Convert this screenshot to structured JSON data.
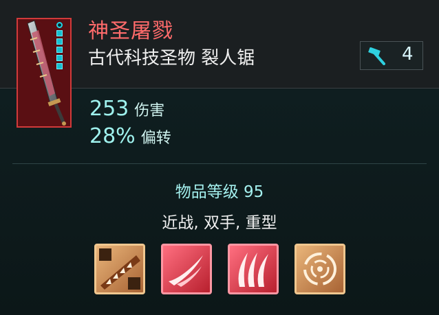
{
  "item": {
    "name": "神圣屠戮",
    "subtitle": "古代科技圣物 裂人锯",
    "crafting_count": "4",
    "rarity_color": "#ff6b6b",
    "icon": "chainsaw-sword-icon",
    "badge_icon": "hammer-icon",
    "mod_slots": 6,
    "mod_slots_filled": 5
  },
  "stats": [
    {
      "value": "253",
      "label": "伤害"
    },
    {
      "value": "28%",
      "label": "偏转"
    }
  ],
  "details": {
    "item_level": "物品等级 95",
    "tags": "近战, 双手, 重型"
  },
  "perks": [
    {
      "icon": "saw-blade-perk-icon",
      "color": "bronze"
    },
    {
      "icon": "slash-wind-perk-icon",
      "color": "red"
    },
    {
      "icon": "triple-slash-perk-icon",
      "color": "red"
    },
    {
      "icon": "swirl-perk-icon",
      "color": "bronze"
    }
  ]
}
